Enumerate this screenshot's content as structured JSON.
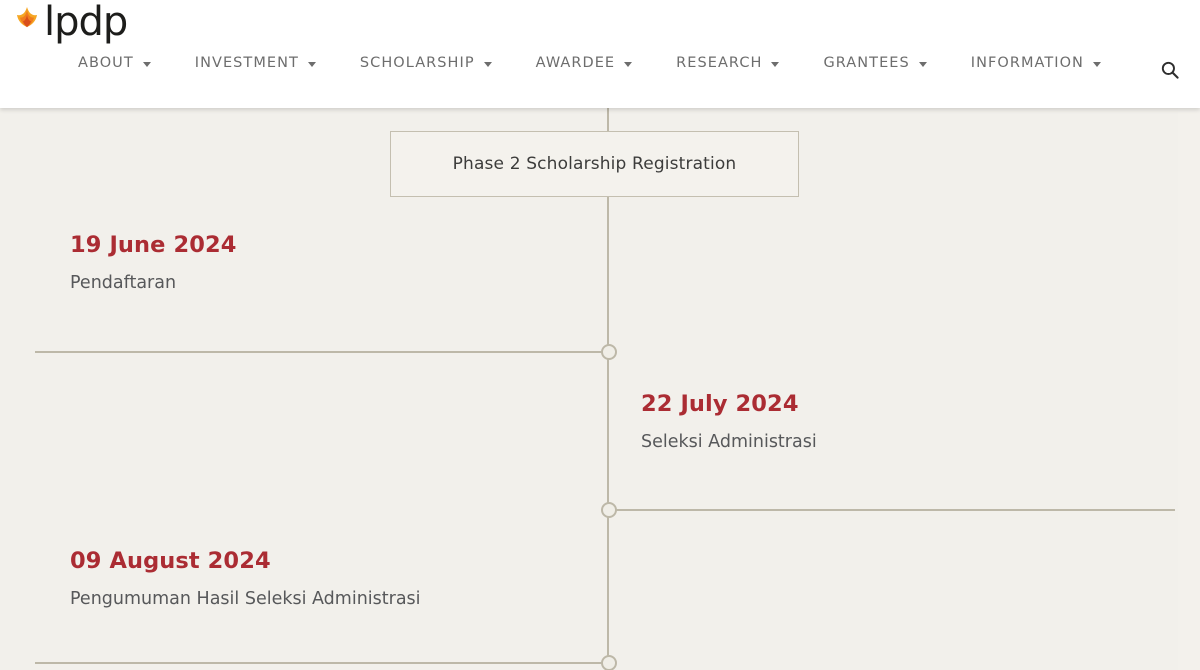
{
  "site": {
    "logo_text": "lpdp",
    "logo_icon": "flame-icon",
    "logo_colors": {
      "flame_top": "#f5a623",
      "flame_mid": "#f07c1e",
      "flame_dark": "#d94f1a",
      "wordmark": "#1d1d1b"
    }
  },
  "nav": {
    "items": [
      {
        "label": "ABOUT",
        "has_dropdown": true
      },
      {
        "label": "INVESTMENT",
        "has_dropdown": true
      },
      {
        "label": "SCHOLARSHIP",
        "has_dropdown": true
      },
      {
        "label": "AWARDEE",
        "has_dropdown": true
      },
      {
        "label": "RESEARCH",
        "has_dropdown": true
      },
      {
        "label": "GRANTEES",
        "has_dropdown": true
      },
      {
        "label": "INFORMATION",
        "has_dropdown": true
      }
    ],
    "search_icon": "search-icon"
  },
  "timeline": {
    "heading": "Phase 2 Scholarship Registration",
    "accent_color": "#ab2c33",
    "line_color": "#bdb8a8",
    "background": "#f2f0eb",
    "entries": [
      {
        "date": "19 June 2024",
        "description": "Pendaftaran",
        "side": "left"
      },
      {
        "date": "22 July 2024",
        "description": "Seleksi Administrasi",
        "side": "right"
      },
      {
        "date": "09 August 2024",
        "description": "Pengumuman Hasil Seleksi Administrasi",
        "side": "left"
      }
    ]
  }
}
